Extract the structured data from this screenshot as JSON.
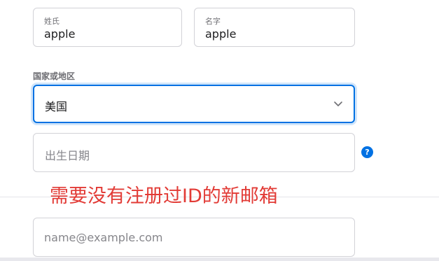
{
  "form": {
    "last_name": {
      "label": "姓氏",
      "value": "apple"
    },
    "first_name": {
      "label": "名字",
      "value": "apple"
    },
    "country": {
      "label": "国家或地区",
      "value": "美国"
    },
    "birthday": {
      "placeholder": "出生日期"
    },
    "help_icon": "?",
    "email": {
      "placeholder": "name@example.com",
      "value": ""
    }
  },
  "annotation": "需要没有注册过ID的新邮箱",
  "colors": {
    "accent": "#0071e3",
    "annotation": "#e23b36"
  }
}
